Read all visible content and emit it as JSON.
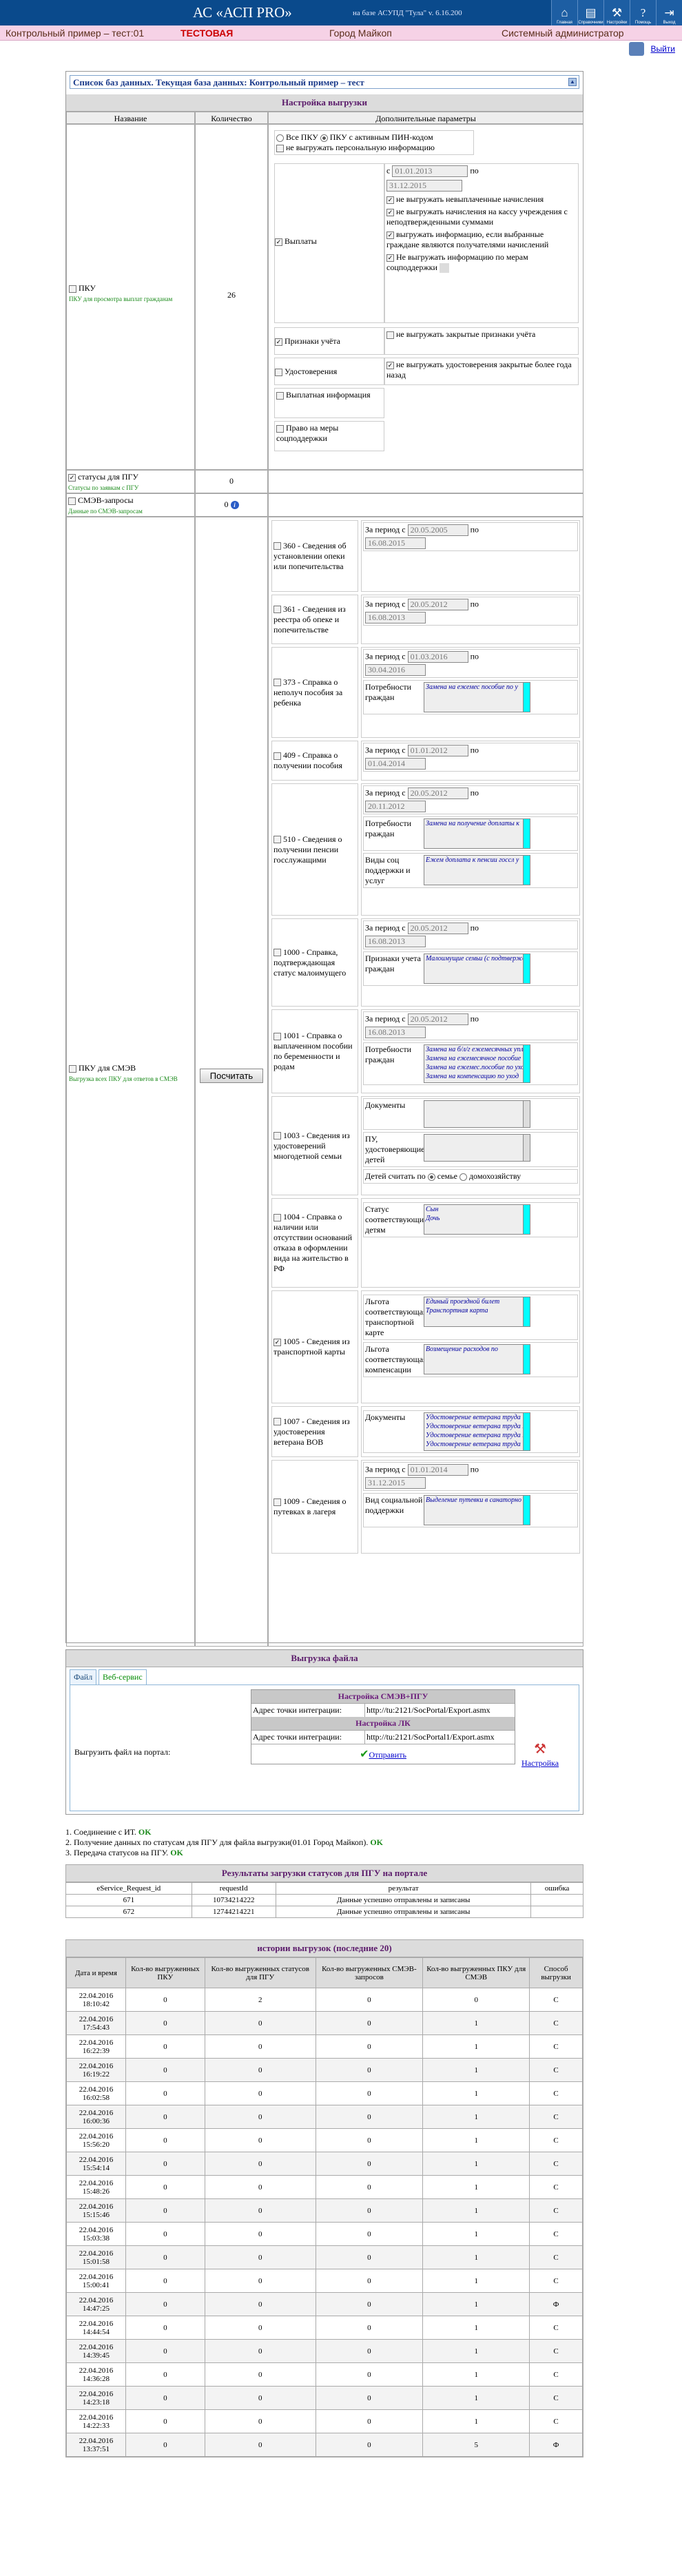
{
  "header": {
    "title": "АС «АСП PRO»",
    "base": "на базе АСУПД \"Тула\"   v. 6.16.200",
    "icons": [
      "Главная",
      "Справочники",
      "Настройки",
      "Помощь",
      "Выход"
    ]
  },
  "subheader": {
    "example": "Контрольный пример – тест:01",
    "test": "ТЕСТОВАЯ",
    "city": "Город Майкоп",
    "role": "Системный администратор"
  },
  "exit": "Выйти",
  "db": {
    "label": "Список баз данных. Текущая база данных: Контрольный пример – тест"
  },
  "settings": {
    "title": "Настройка выгрузки",
    "columns": [
      "Название",
      "Количество",
      "Дополнительные параметры"
    ],
    "pku": {
      "label": "ПКУ",
      "note": "ПКУ для просмотра выплат гражданам",
      "count": "26",
      "radio_all": "Все ПКУ",
      "radio_pin": "ПКУ с активным ПИН-кодом",
      "no_personal": "не выгружать персональную информацию",
      "payments": "Выплаты",
      "pay_from": "01.01.2013",
      "pay_to": "31.12.2015",
      "po": "по",
      "s": "с",
      "opt1": "не выгружать невыплаченные начисления",
      "opt2": "не выгружать начисления на кассу учреждения с неподтвержденными суммами",
      "opt3": "выгружать информацию, если выбранные граждане являются получателями начислений",
      "opt4": "Не выгружать информацию по мерам соцподдержки",
      "signs": "Признаки учёта",
      "signs_opt": "не выгружать закрытые признаки учёта",
      "certs": "Удостоверения",
      "certs_opt": "не выгружать удостоверения закрытые более года назад",
      "payinfo": "Выплатная информация",
      "right": "Право на меры соцподдержки"
    },
    "status": {
      "label": "статусы для ПГУ",
      "note": "Статусы по заявкам с ПГУ",
      "count": "0"
    },
    "smev": {
      "label": "СМЭВ-запросы",
      "note": "Данные по СМЭВ-запросам",
      "count": "0"
    },
    "smev_pku": {
      "label": "ПКУ для СМЭВ",
      "note": "Выгрузка всех ПКУ для ответов в СМЭВ",
      "button": "Посчитать"
    },
    "period": "За период с",
    "rows": [
      {
        "name": "360 - Сведения об установлении опеки или попечительства",
        "from": "20.05.2005",
        "to": "16.08.2015"
      },
      {
        "name": "361 - Сведения из реестра об опеке и попечительстве",
        "from": "20.05.2012",
        "to": "16.08.2013"
      },
      {
        "name": "373 - Справка о неполуч пособия за ребенка",
        "from": "01.03.2016",
        "to": "30.04.2016",
        "needs": "Потребности граждан",
        "list": [
          "Замена на ежемес пособие по у"
        ]
      },
      {
        "name": "409 - Справка о получении пособия",
        "from": "01.01.2012",
        "to": "01.04.2014"
      },
      {
        "name": "510 - Сведения о получении пенсии госслужащими",
        "from": "20.05.2012",
        "to": "20.11.2012",
        "needs": "Потребности граждан",
        "list": [
          "Замена на получение доплаты к"
        ],
        "kinds": "Виды соц поддержки и услуг",
        "list2": [
          "Ежем доплата к пенсии госсл у"
        ]
      },
      {
        "name": "1000 - Справка, подтверждающая статус малоимущего",
        "from": "20.05.2012",
        "to": "16.08.2013",
        "signs": "Признаки учета граждан",
        "list": [
          "Малоимущие семьи (с подтвержден"
        ]
      },
      {
        "name": "1001 - Справка о выплаченном пособии по беременности и родам",
        "from": "20.05.2012",
        "to": "16.08.2013",
        "needs": "Потребности граждан",
        "list": [
          "Замена на б/л/г ежемесячных упл",
          "Замена на ежемесячное пособие",
          "Замена на ежемес.пособие по уход",
          "Замена на компенсацию по уход"
        ]
      },
      {
        "name": "1003 - Сведения из удостоверений многодетной семьи",
        "docs": "Документы",
        "certs": "ПУ, удостоверяющие детей",
        "count_as": "Детей считать по",
        "family": "семье",
        "household": "домохозяйству"
      },
      {
        "name": "1004 - Справка о наличии или отсутствии оснований отказа в оформлении вида на жительство в РФ",
        "status": "Статус соответствующий детям",
        "list": [
          "Сын",
          "Дочь"
        ]
      },
      {
        "name": "1005 - Сведения из транспортной карты",
        "ben1": "Льгота соответствующая транспортной карте",
        "list": [
          "Единый проездной билет",
          "Транспортная карта"
        ],
        "ben2": "Льгота соответствующая компенсации",
        "list2": [
          "Возмещение расходов по"
        ]
      },
      {
        "name": "1007 - Сведения из удостоверения ветерана ВОВ",
        "docs": "Документы",
        "list": [
          "Удостоверение ветерана труда",
          "Удостоверение ветерана труда М",
          "Удостоверение ветерана труда РФ",
          "Удостоверение ветерана труда"
        ]
      },
      {
        "name": "1009 - Сведения о путевках в лагеря",
        "from": "01.01.2014",
        "to": "31.12.2015",
        "kind": "Вид социальной поддержки",
        "list": [
          "Выделение путевки в санаторно"
        ]
      }
    ]
  },
  "upload": {
    "title": "Выгрузка файла",
    "tabs": [
      "Файл",
      "Веб-сервис"
    ],
    "portal": "Выгрузить файл на портал:",
    "smev_title": "Настройка СМЭВ+ПГУ",
    "addr": "Адрес точки интеграции:",
    "url1": "http://tu:2121/SocPortal/Export.asmx",
    "lk_title": "Настройка ЛК",
    "url2": "http://tu:2121/SocPortal1/Export.asmx",
    "settings_link": "Настройка",
    "send": "Отправить"
  },
  "log": [
    {
      "text": "1. Соединение с ИТ. ",
      "ok": "OK"
    },
    {
      "text": "2. Получение данных по статусам для ПГУ для файла выгрузки(01.01 Город Майкоп). ",
      "ok": "OK"
    },
    {
      "text": "3. Передача статусов на ПГУ. ",
      "ok": "OK"
    }
  ],
  "results": {
    "title": "Результаты загрузки статусов для ПГУ на портале",
    "columns": [
      "eService_Request_id",
      "requestId",
      "результат",
      "ошибка"
    ],
    "rows": [
      [
        "671",
        "10734214222",
        "Данные успешно отправлены и записаны",
        ""
      ],
      [
        "672",
        "12744214221",
        "Данные успешно отправлены и записаны",
        ""
      ]
    ]
  },
  "history": {
    "title": "истории выгрузок (последние 20)",
    "columns": [
      "Дата и время",
      "Кол-во выгруженных ПКУ",
      "Кол-во выгруженных статусов для ПГУ",
      "Кол-во выгруженных СМЭВ-запросов",
      "Кол-во выгруженных ПКУ для СМЭВ",
      "Способ выгрузки"
    ],
    "rows": [
      [
        "22.04.2016 18:10:42",
        "0",
        "2",
        "0",
        "0",
        "С"
      ],
      [
        "22.04.2016 17:54:43",
        "0",
        "0",
        "0",
        "1",
        "С"
      ],
      [
        "22.04.2016 16:22:39",
        "0",
        "0",
        "0",
        "1",
        "С"
      ],
      [
        "22.04.2016 16:19:22",
        "0",
        "0",
        "0",
        "1",
        "С"
      ],
      [
        "22.04.2016 16:02:58",
        "0",
        "0",
        "0",
        "1",
        "С"
      ],
      [
        "22.04.2016 16:00:36",
        "0",
        "0",
        "0",
        "1",
        "С"
      ],
      [
        "22.04.2016 15:56:20",
        "0",
        "0",
        "0",
        "1",
        "С"
      ],
      [
        "22.04.2016 15:54:14",
        "0",
        "0",
        "0",
        "1",
        "С"
      ],
      [
        "22.04.2016 15:48:26",
        "0",
        "0",
        "0",
        "1",
        "С"
      ],
      [
        "22.04.2016 15:15:46",
        "0",
        "0",
        "0",
        "1",
        "С"
      ],
      [
        "22.04.2016 15:03:38",
        "0",
        "0",
        "0",
        "1",
        "С"
      ],
      [
        "22.04.2016 15:01:58",
        "0",
        "0",
        "0",
        "1",
        "С"
      ],
      [
        "22.04.2016 15:00:41",
        "0",
        "0",
        "0",
        "1",
        "С"
      ],
      [
        "22.04.2016 14:47:25",
        "0",
        "0",
        "0",
        "1",
        "Ф"
      ],
      [
        "22.04.2016 14:44:54",
        "0",
        "0",
        "0",
        "1",
        "С"
      ],
      [
        "22.04.2016 14:39:45",
        "0",
        "0",
        "0",
        "1",
        "С"
      ],
      [
        "22.04.2016 14:36:28",
        "0",
        "0",
        "0",
        "1",
        "С"
      ],
      [
        "22.04.2016 14:23:18",
        "0",
        "0",
        "0",
        "1",
        "С"
      ],
      [
        "22.04.2016 14:22:33",
        "0",
        "0",
        "0",
        "1",
        "С"
      ],
      [
        "22.04.2016 13:37:51",
        "0",
        "0",
        "0",
        "5",
        "Ф"
      ]
    ]
  }
}
